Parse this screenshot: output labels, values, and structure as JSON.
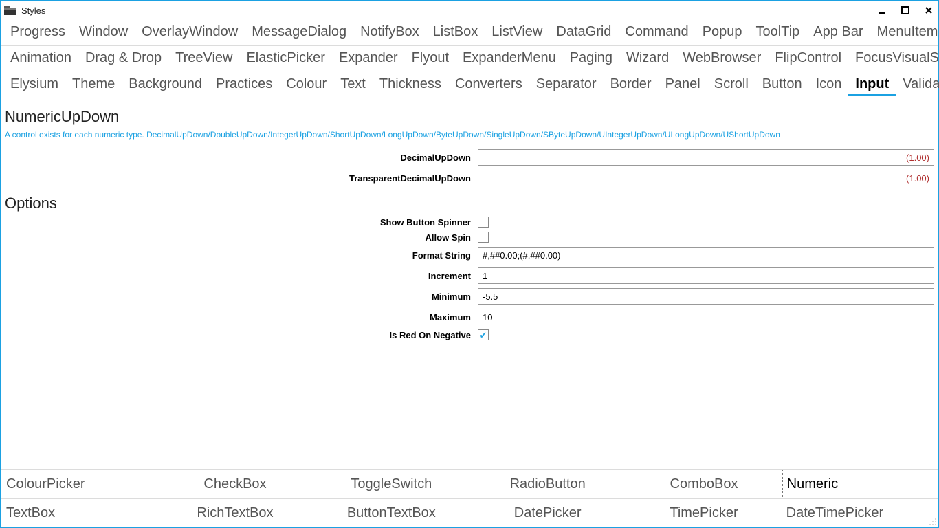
{
  "window": {
    "title": "Styles"
  },
  "top_tabs": {
    "row1": [
      "Progress",
      "Window",
      "OverlayWindow",
      "MessageDialog",
      "NotifyBox",
      "ListBox",
      "ListView",
      "DataGrid",
      "Command",
      "Popup",
      "ToolTip",
      "App Bar",
      "MenuItem"
    ],
    "row2": [
      "Animation",
      "Drag & Drop",
      "TreeView",
      "ElasticPicker",
      "Expander",
      "Flyout",
      "ExpanderMenu",
      "Paging",
      "Wizard",
      "WebBrowser",
      "FlipControl",
      "FocusVisualStyle"
    ],
    "row3": [
      "Elysium",
      "Theme",
      "Background",
      "Practices",
      "Colour",
      "Text",
      "Thickness",
      "Converters",
      "Separator",
      "Border",
      "Panel",
      "Scroll",
      "Button",
      "Icon",
      "Input",
      "Validation"
    ],
    "row3_selected_index": 14
  },
  "section": {
    "heading": "NumericUpDown",
    "description": "A control exists for each numeric type. DecimalUpDown/DoubleUpDown/IntegerUpDown/ShortUpDown/LongUpDown/ByteUpDown/SingleUpDown/SByteUpDown/UIntegerUpDown/ULongUpDown/UShortUpDown",
    "options_heading": "Options"
  },
  "fields": {
    "decimal_label": "DecimalUpDown",
    "decimal_value": "(1.00)",
    "transparent_label": "TransparentDecimalUpDown",
    "transparent_value": "(1.00)",
    "show_spinner_label": "Show Button Spinner",
    "show_spinner_checked": false,
    "allow_spin_label": "Allow Spin",
    "allow_spin_checked": false,
    "format_label": "Format String",
    "format_value": "#,##0.00;(#,##0.00)",
    "increment_label": "Increment",
    "increment_value": "1",
    "minimum_label": "Minimum",
    "minimum_value": "-5.5",
    "maximum_label": "Maximum",
    "maximum_value": "10",
    "red_neg_label": "Is Red On Negative",
    "red_neg_checked": true
  },
  "bottom_tabs": {
    "row1": [
      "ColourPicker",
      "CheckBox",
      "ToggleSwitch",
      "RadioButton",
      "ComboBox",
      "Numeric"
    ],
    "row1_selected_index": 5,
    "row2": [
      "TextBox",
      "RichTextBox",
      "ButtonTextBox",
      "DatePicker",
      "TimePicker",
      "DateTimePicker"
    ]
  }
}
